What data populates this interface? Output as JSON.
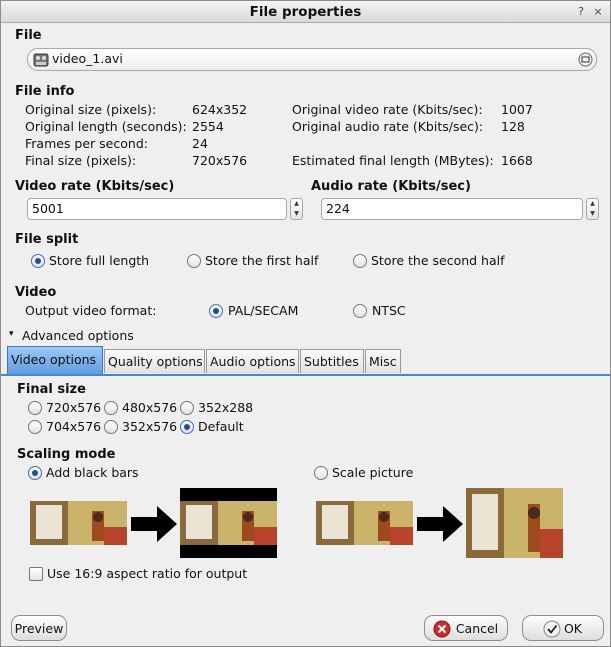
{
  "window": {
    "title": "File properties",
    "controls": {
      "help": "?",
      "close": "×"
    }
  },
  "file": {
    "heading": "File",
    "filename": "video_1.avi"
  },
  "file_info": {
    "heading": "File info",
    "original_size_label": "Original size (pixels):",
    "original_size_value": "624x352",
    "original_length_label": "Original length (seconds):",
    "original_length_value": "2554",
    "fps_label": "Frames per second:",
    "fps_value": "24",
    "final_size_label": "Final size (pixels):",
    "final_size_value": "720x576",
    "orig_video_rate_label": "Original video rate (Kbits/sec):",
    "orig_video_rate_value": "1007",
    "orig_audio_rate_label": "Original audio rate (Kbits/sec):",
    "orig_audio_rate_value": "128",
    "est_final_length_label": "Estimated final length (MBytes):",
    "est_final_length_value": "1668"
  },
  "video_rate": {
    "heading": "Video rate (Kbits/sec)",
    "value": "5001"
  },
  "audio_rate": {
    "heading": "Audio rate (Kbits/sec)",
    "value": "224"
  },
  "file_split": {
    "heading": "File split",
    "options": [
      "Store full length",
      "Store the first half",
      "Store the second half"
    ],
    "selected": "Store full length"
  },
  "video": {
    "heading": "Video",
    "format_label": "Output video format:",
    "options": [
      "PAL/SECAM",
      "NTSC"
    ],
    "selected": "PAL/SECAM"
  },
  "advanced": {
    "label": "Advanced options",
    "expander": "▾"
  },
  "tabs": [
    "Video options",
    "Quality options",
    "Audio options",
    "Subtitles",
    "Misc"
  ],
  "active_tab": "Video options",
  "final_size": {
    "heading": "Final size",
    "options": [
      "720x576",
      "480x576",
      "352x288",
      "704x576",
      "352x576",
      "Default"
    ],
    "selected": "Default"
  },
  "scaling": {
    "heading": "Scaling mode",
    "options": [
      "Add black bars",
      "Scale picture"
    ],
    "selected": "Add black bars"
  },
  "aspect_checkbox": {
    "label": "Use 16:9 aspect ratio for output",
    "checked": false
  },
  "buttons": {
    "preview": "Preview",
    "cancel": "Cancel",
    "ok": "OK"
  },
  "colors": {
    "accent": "#4a86d0",
    "tab_active": "#6fa8e8",
    "cancel_icon": "#d22b2b"
  }
}
